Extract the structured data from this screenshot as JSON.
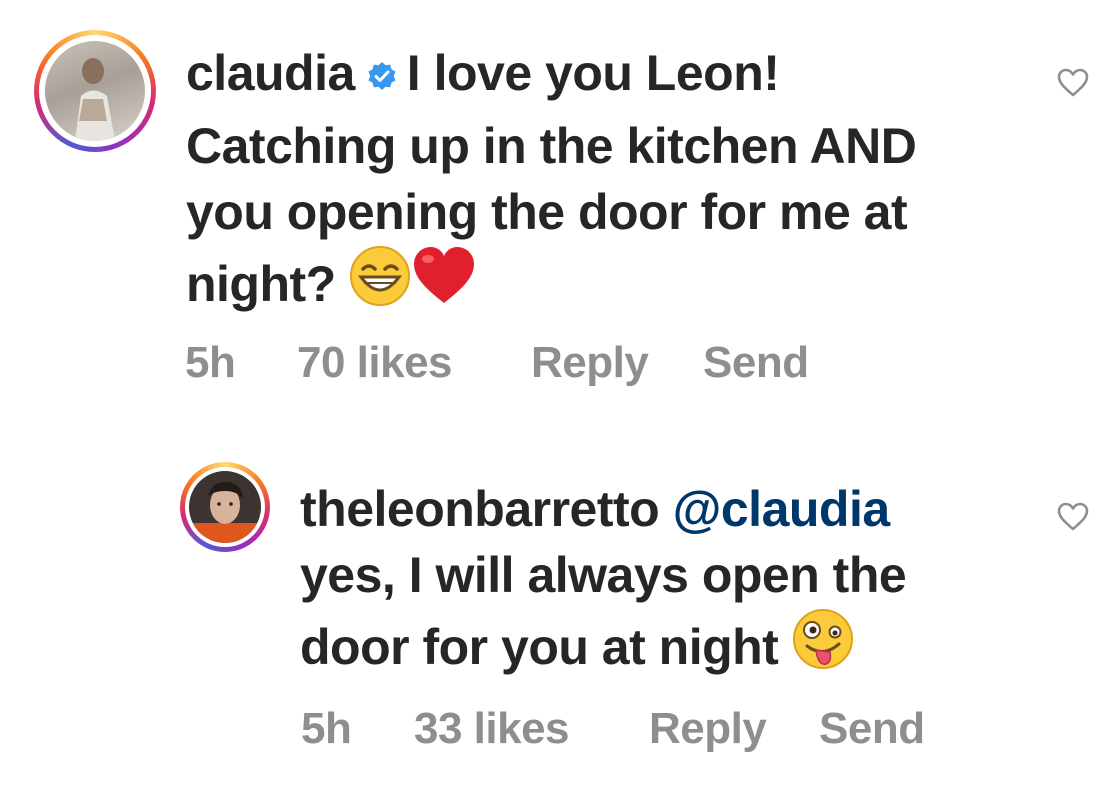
{
  "comments": [
    {
      "username": "claudia",
      "verified": true,
      "text_line1": "I love you Leon!",
      "text_line2": "Catching up in the kitchen AND",
      "text_line3": "you opening the door for me at",
      "text_line4": "night?",
      "emojis": [
        "grinning-face-with-smiling-eyes",
        "red-heart"
      ],
      "time": "5h",
      "likes": "70 likes",
      "reply_label": "Reply",
      "send_label": "Send"
    },
    {
      "username": "theleonbarretto",
      "mention": "@claudia",
      "text_line1": "yes, I will always open the",
      "text_line2": "door for you at night",
      "emojis": [
        "zany-face"
      ],
      "time": "5h",
      "likes": "33 likes",
      "reply_label": "Reply",
      "send_label": "Send"
    }
  ],
  "colors": {
    "text": "#262626",
    "meta": "#8e8e8e",
    "mention": "#00376b",
    "verified": "#3897f0",
    "heart": "#e0202d"
  }
}
